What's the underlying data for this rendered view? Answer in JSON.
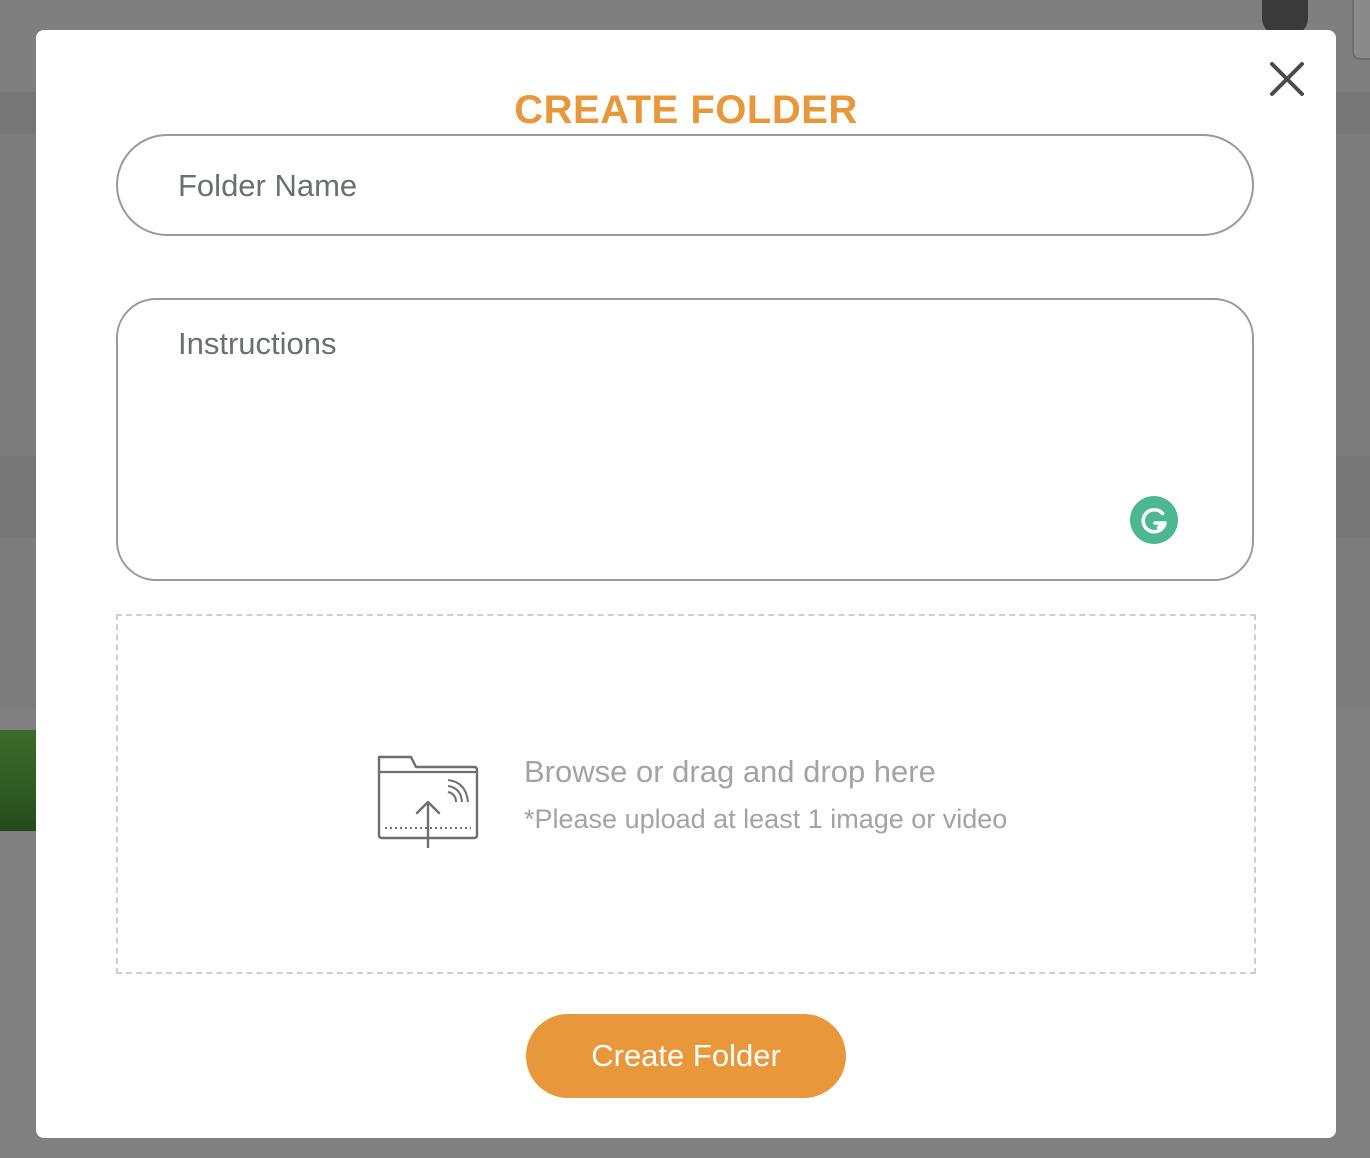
{
  "modal": {
    "title": "CREATE FOLDER",
    "close_icon": "close-icon",
    "folder_name": {
      "placeholder": "Folder Name",
      "value": ""
    },
    "instructions": {
      "placeholder": "Instructions",
      "value": "",
      "assistant_icon": "grammarly-icon"
    },
    "dropzone": {
      "icon": "folder-upload-icon",
      "main_text": "Browse or drag and drop here",
      "sub_text": "*Please upload at least 1 image or video"
    },
    "submit_label": "Create Folder"
  },
  "colors": {
    "accent": "#e8973b",
    "overlay": "#808080",
    "grammarly": "#4db88f",
    "placeholder_text": "#6b6e73",
    "hint_text": "#a3a3a3"
  }
}
